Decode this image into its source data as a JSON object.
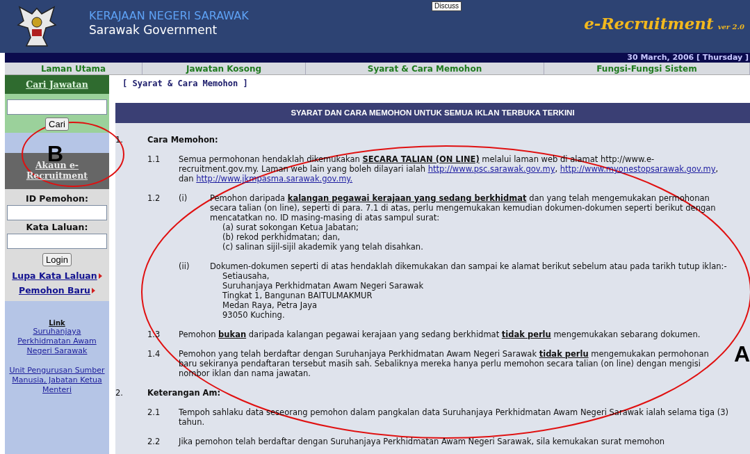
{
  "tooltip": "Discuss",
  "header": {
    "title": "KERAJAAN NEGERI SARAWAK",
    "subtitle": "Sarawak Government",
    "app_name": "e-Recruitment",
    "version": "ver 2.0"
  },
  "date": "30 March, 2006 [ Thursday ]",
  "nav": [
    "Laman Utama",
    "Jawatan Kosong",
    "Syarat & Cara Memohon",
    "Fungsi-Fungsi Sistem"
  ],
  "sidebar": {
    "search_heading": "Cari Jawatan",
    "search_button": "Cari",
    "account_heading": "Akaun e-Recruitment",
    "id_label": "ID Pemohon:",
    "password_label": "Kata Laluan:",
    "login_button": "Login",
    "links": [
      "Lupa Kata Laluan",
      "Pemohon Baru"
    ],
    "link_heading": "Link",
    "external_links": [
      "Suruhanjaya Perkhidmatan Awam Negeri Sarawak",
      "Unit Pengurusan Sumber Manusia, Jabatan Ketua Menteri"
    ]
  },
  "breadcrumb": "[ Syarat & Cara Memohon ]",
  "panel_title": "SYARAT DAN CARA MEMOHON UNTUK SEMUA IKLAN TERBUKA TERKINI",
  "sections": [
    {
      "number": "1.",
      "title": "Cara Memohon:",
      "items": [
        {
          "number": "1.1",
          "parts": [
            {
              "kind": "text",
              "text": "Semua permohonan hendaklah dikemukakan **SECARA TALIAN (ON LINE)** melalui laman web di alamat http://www.e-recruitment.gov.my. Laman web lain yang boleh dilayari ialah "
            },
            {
              "kind": "link",
              "text": "http://www.psc.sarawak.gov.my"
            },
            {
              "kind": "text",
              "text": ", "
            },
            {
              "kind": "link",
              "text": "http://www.myonestopsarawak.gov.my"
            },
            {
              "kind": "text",
              "text": ", dan "
            },
            {
              "kind": "link",
              "text": "http://www.jkmpasma.sarawak.gov.my."
            }
          ]
        },
        {
          "number": "1.2",
          "subitems": [
            {
              "number": "(i)",
              "parts": [
                {
                  "kind": "text",
                  "text": "Pemohon daripada **kalangan pegawai kerajaan yang sedang berkhidmat** dan yang telah mengemukakan permohonan secara talian (on line), seperti di para. 7.1 di atas, perlu mengemukakan kemudian dokumen-dokumen seperti berikut dengan mencatatkan no. ID masing-masing di atas sampul surat:"
                }
              ],
              "lines": [
                "(a) surat sokongan Ketua Jabatan;",
                "(b) rekod perkhidmatan; dan,",
                "(c) salinan sijil-sijil akademik yang telah disahkan."
              ]
            },
            {
              "number": "(ii)",
              "parts": [
                {
                  "kind": "text",
                  "text": "Dokumen-dokumen seperti di atas hendaklah dikemukakan dan sampai ke alamat berikut sebelum atau pada tarikh tutup iklan:-"
                }
              ],
              "lines": [
                "Setiausaha,",
                "Suruhanjaya Perkhidmatan Awam Negeri Sarawak",
                "Tingkat 1, Bangunan BAITULMAKMUR",
                "Medan Raya, Petra Jaya",
                "93050 Kuching."
              ]
            }
          ]
        },
        {
          "number": "1.3",
          "parts": [
            {
              "kind": "text",
              "text": "Pemohon **bukan** daripada kalangan pegawai kerajaan yang sedang berkhidmat **tidak perlu** mengemukakan sebarang dokumen."
            }
          ]
        },
        {
          "number": "1.4",
          "parts": [
            {
              "kind": "text",
              "text": "Pemohon yang telah berdaftar dengan Suruhanjaya Perkhidmatan Awam Negeri Sarawak **tidak perlu** mengemukakan permohonan baru sekiranya pendaftaran tersebut masih sah. Sebaliknya mereka hanya perlu memohon secara talian (on line) dengan mengisi nombor iklan dan nama jawatan."
            }
          ]
        }
      ]
    },
    {
      "number": "2.",
      "title": "Keterangan Am:",
      "items": [
        {
          "number": "2.1",
          "parts": [
            {
              "kind": "text",
              "text": "Tempoh sahlaku data seseorang pemohon dalam pangkalan data Suruhanjaya Perkhidmatan Awam Negeri Sarawak ialah selama tiga (3) tahun."
            }
          ]
        },
        {
          "number": "2.2",
          "parts": [
            {
              "kind": "text",
              "text": "Jika pemohon telah berdaftar dengan Suruhanjaya Perkhidmatan Awam Negeri Sarawak, sila kemukakan surat memohon"
            }
          ]
        }
      ]
    }
  ],
  "annotations": [
    {
      "label": "B",
      "kind": "small"
    },
    {
      "label": "A",
      "kind": "large"
    }
  ]
}
